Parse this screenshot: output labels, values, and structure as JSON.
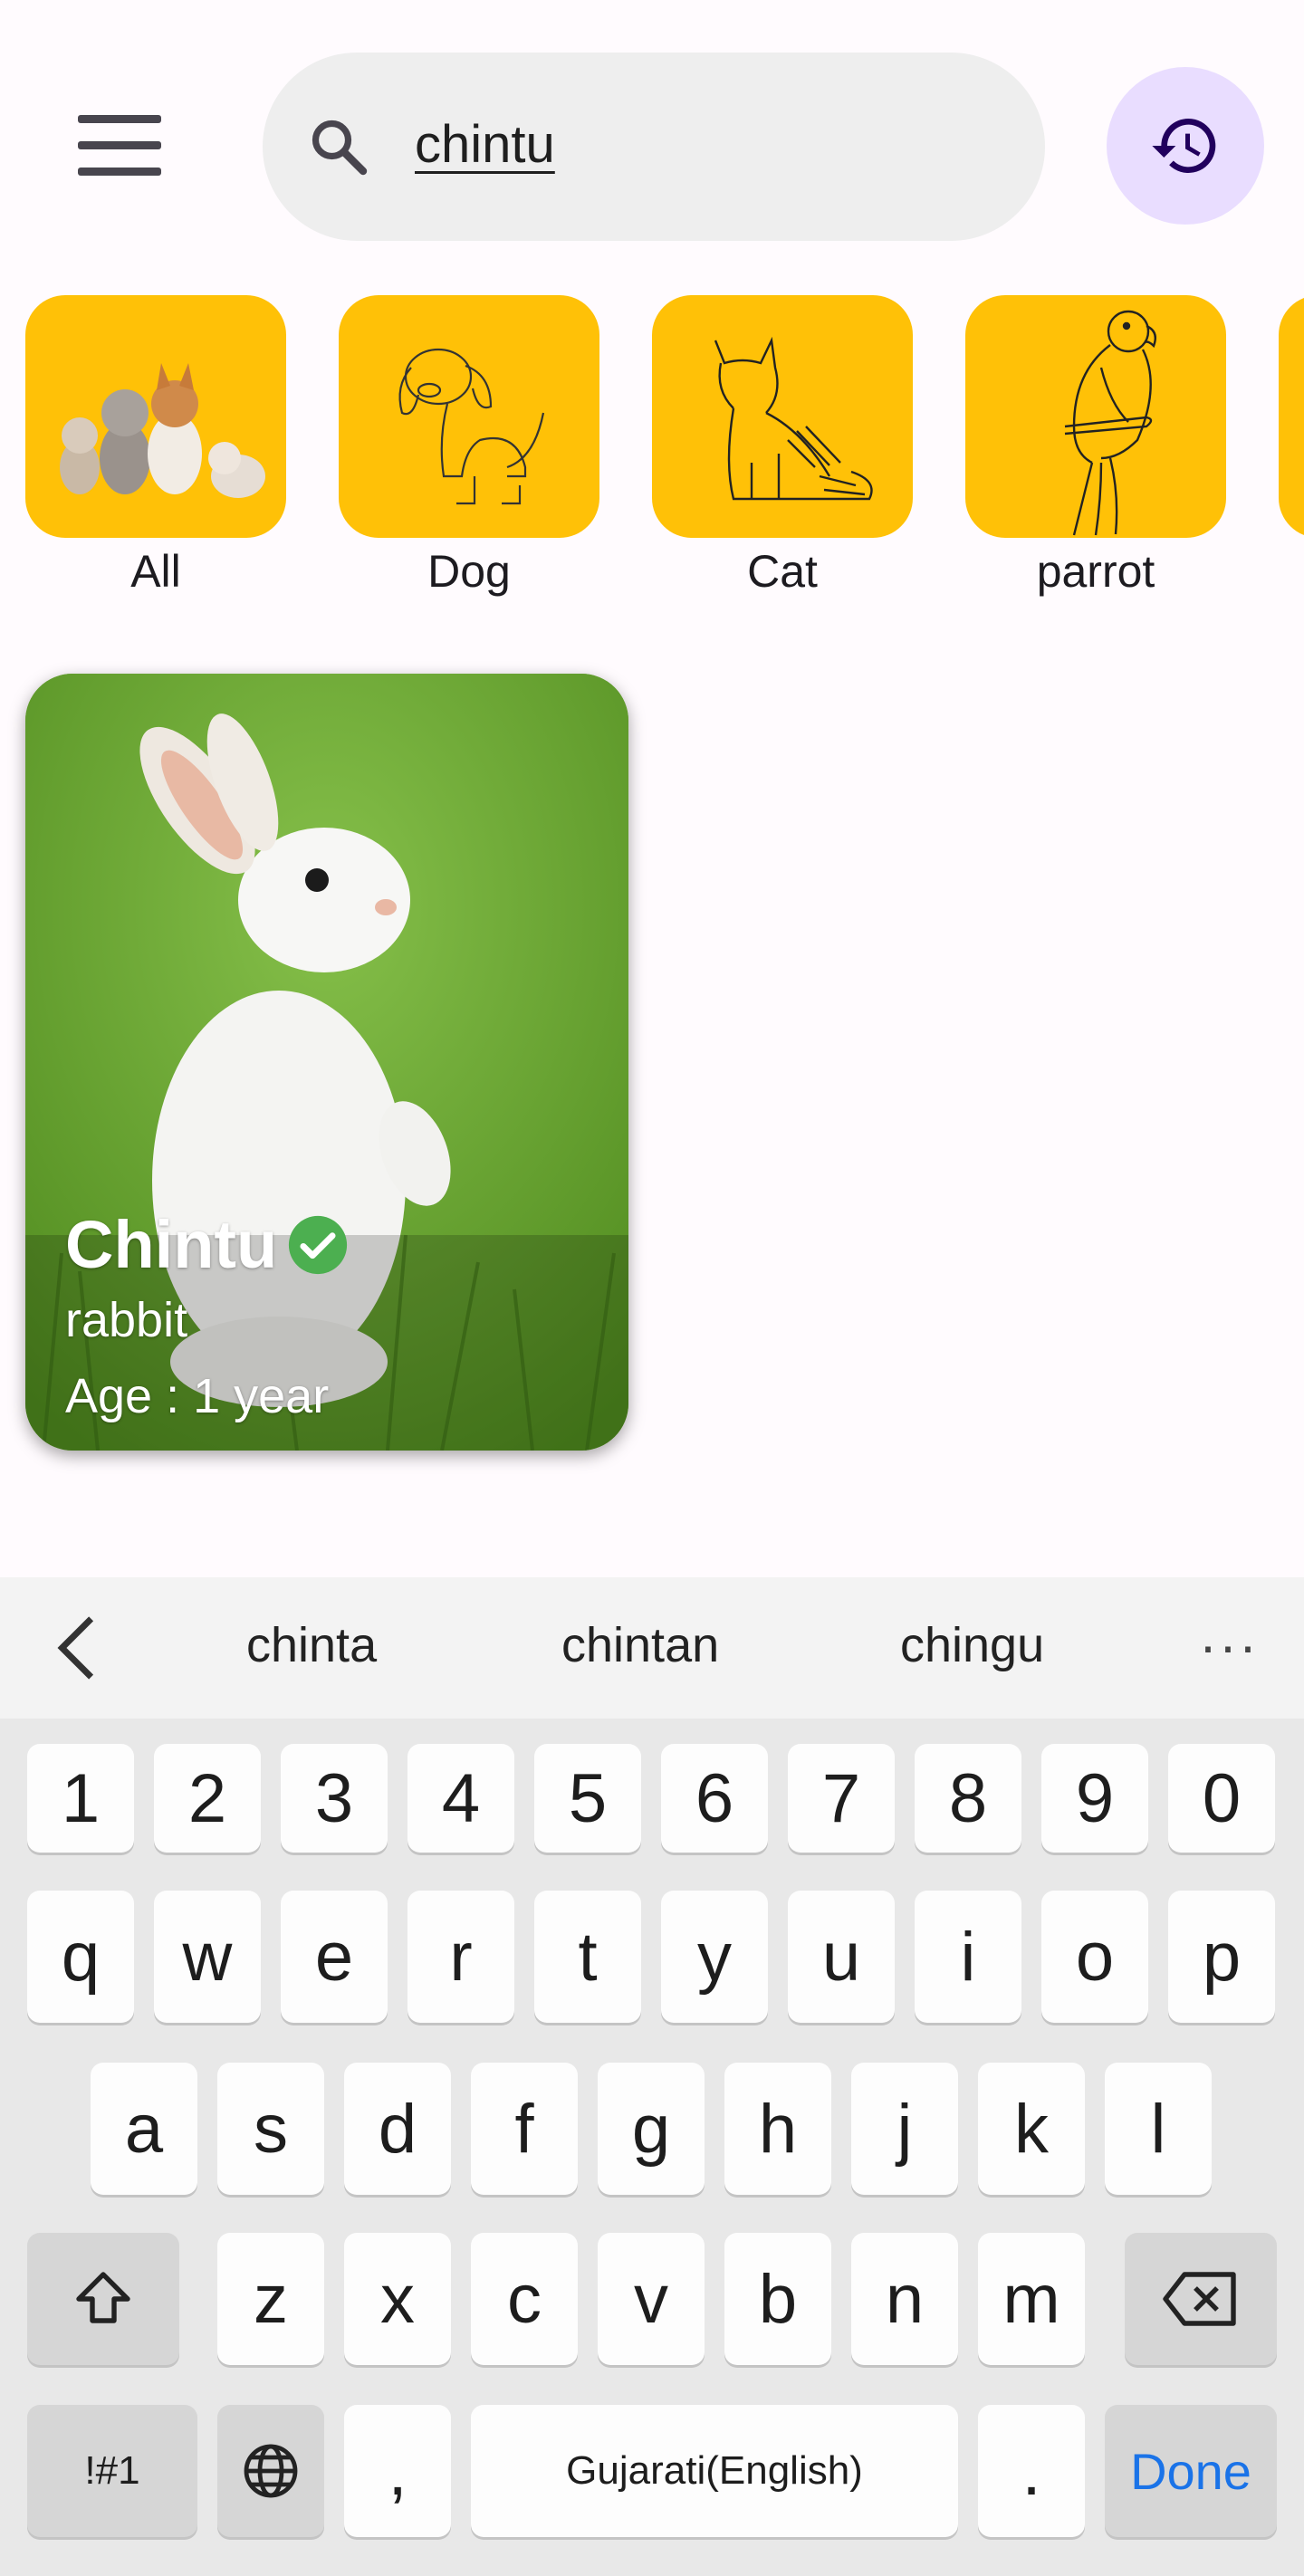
{
  "search": {
    "query": "chintu"
  },
  "categories": [
    {
      "label": "All"
    },
    {
      "label": "Dog"
    },
    {
      "label": "Cat"
    },
    {
      "label": "parrot"
    }
  ],
  "pet_card": {
    "name": "Chintu",
    "type": "rabbit",
    "age": "Age : 1 year",
    "verified": true
  },
  "keyboard": {
    "suggestions": [
      "chinta",
      "chintan",
      "chingu"
    ],
    "more": "···",
    "row_numbers": [
      "1",
      "2",
      "3",
      "4",
      "5",
      "6",
      "7",
      "8",
      "9",
      "0"
    ],
    "row_top": [
      "q",
      "w",
      "e",
      "r",
      "t",
      "y",
      "u",
      "i",
      "o",
      "p"
    ],
    "row_mid": [
      "a",
      "s",
      "d",
      "f",
      "g",
      "h",
      "j",
      "k",
      "l"
    ],
    "row_bottom": [
      "z",
      "x",
      "c",
      "v",
      "b",
      "n",
      "m"
    ],
    "symbols_label": "!#1",
    "comma": ",",
    "space_label": "Gujarati(English)",
    "period": ".",
    "done_label": "Done"
  },
  "colors": {
    "category_tile": "#ffc107",
    "history_button": "#e9ddff",
    "verified_badge": "#4caf50",
    "done_text": "#1a73e8"
  },
  "icons": {
    "menu": "menu-icon",
    "search": "search-icon",
    "history": "history-icon",
    "verified": "verified-check-icon",
    "shift": "shift-icon",
    "backspace": "backspace-icon",
    "globe": "globe-icon",
    "suggestion_back": "chevron-left-icon"
  }
}
